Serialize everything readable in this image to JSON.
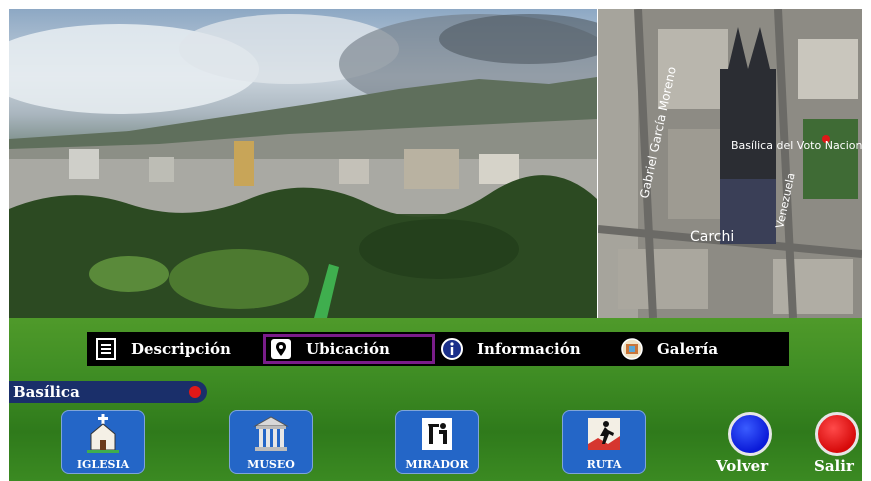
{
  "video": {
    "scene": "aerial-city-park-view"
  },
  "map": {
    "labels": {
      "street_left": "Gabriel García Moreno",
      "building": "Basílica del Voto Nacional",
      "street_right": "Venezuela",
      "street_bottom": "Carchi"
    }
  },
  "menu": {
    "tabs": [
      {
        "label": "Descripción",
        "icon": "document-icon"
      },
      {
        "label": "Ubicación",
        "icon": "location-pin-icon",
        "selected": true
      },
      {
        "label": "Información",
        "icon": "info-icon"
      },
      {
        "label": "Galería",
        "icon": "gallery-icon"
      }
    ]
  },
  "place": {
    "label": "Basílica",
    "status_color": "#e01818"
  },
  "categories": [
    {
      "label": "IGLESIA",
      "icon": "church-icon"
    },
    {
      "label": "MUSEO",
      "icon": "museum-icon"
    },
    {
      "label": "MIRADOR",
      "icon": "viewpoint-icon"
    },
    {
      "label": "RUTA",
      "icon": "route-icon"
    }
  ],
  "actions": {
    "volver": {
      "label": "Volver",
      "color": "#1a2ee6"
    },
    "salir": {
      "label": "Salir",
      "color": "#e01818"
    }
  },
  "colors": {
    "menu_bg": "#000000",
    "selected_border": "#7a1d8a",
    "button_bg": "#2466c7",
    "place_bar": "#1a2f6a"
  }
}
